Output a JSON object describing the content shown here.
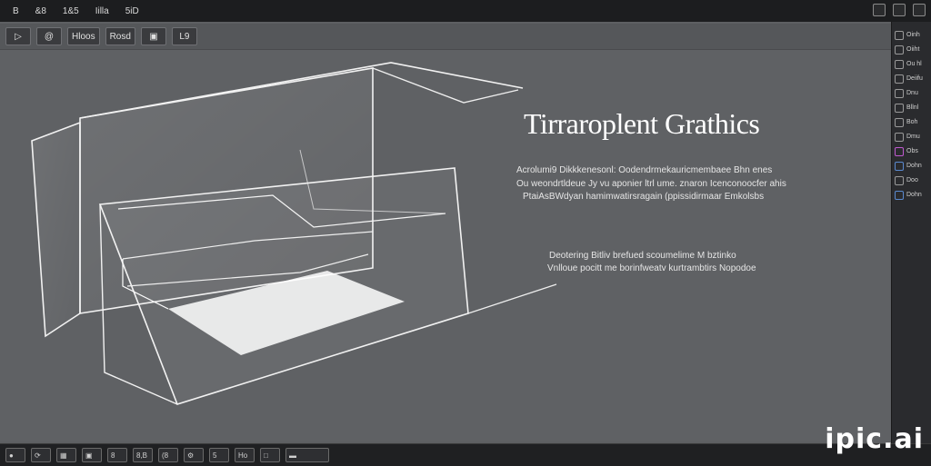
{
  "menubar": {
    "items": [
      "B",
      "&8",
      "1&5",
      "Iilla",
      "5iD"
    ]
  },
  "toolbar": {
    "items": [
      "@",
      "Hloos",
      "Rosd",
      "L9"
    ]
  },
  "viewport": {
    "title": "Tirraroplent Grathics",
    "para1": [
      "Acrolumi9 Dikkkenesonl: Oodendrmekauricmembaee Bhn enes",
      "Ou weondrtldeue Jy vu  aponier ltrl ume. znaron Icenconoocfer ahis",
      "PtaiAsBWdyan hamimwatirsragain (ppissidirmaar Emkolsbs"
    ],
    "para2": [
      "Deotering Bitliv brefued scoumelime M bztinko",
      "Vnlloue pocitt me borinfweatv kurtrambtirs Nopodoe"
    ]
  },
  "right_panel": {
    "rows": [
      "Oinh",
      "Oiiht",
      "Ou hl",
      "Deiifu",
      "Dnu",
      "Bllnl",
      "Boh",
      "Dmu",
      "Obs",
      "Dohn",
      "Doo",
      "Dohn"
    ]
  },
  "statusbar": {
    "items": [
      "8",
      "8,B",
      "(8",
      "5",
      "Ho"
    ]
  },
  "watermark": "ipic.ai"
}
